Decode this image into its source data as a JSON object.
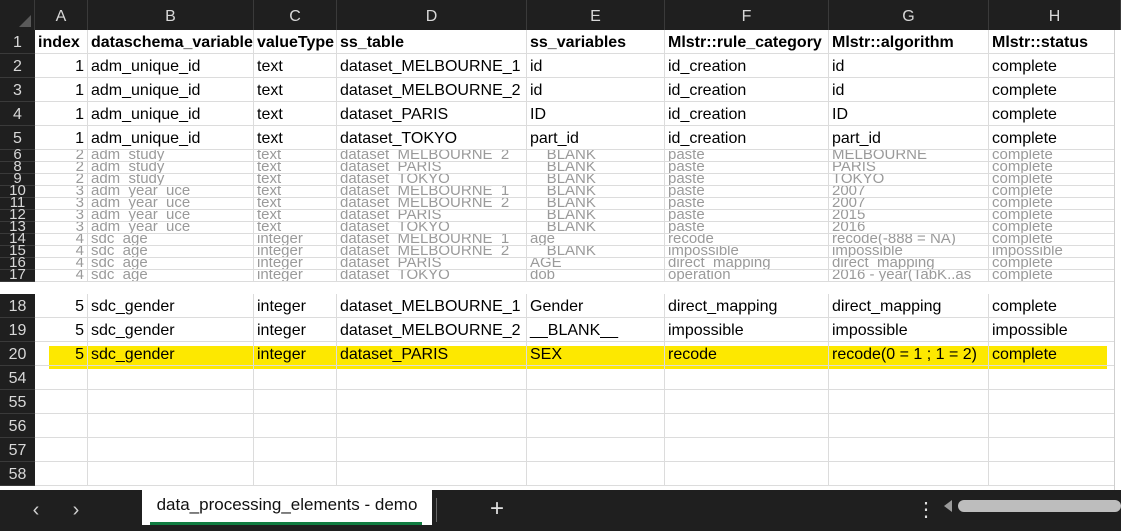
{
  "columns": [
    "A",
    "B",
    "C",
    "D",
    "E",
    "F",
    "G",
    "H"
  ],
  "header_row": {
    "num": "1",
    "cells": [
      "index",
      "dataschema_variable",
      "valueType",
      "ss_table",
      "ss_variables",
      "Mlstr::rule_category",
      "Mlstr::algorithm",
      "Mlstr::status"
    ]
  },
  "rows": [
    {
      "num": "2",
      "cells": [
        "1",
        "adm_unique_id",
        "text",
        "dataset_MELBOURNE_1",
        "id",
        "id_creation",
        "id",
        "complete"
      ]
    },
    {
      "num": "3",
      "cells": [
        "1",
        "adm_unique_id",
        "text",
        "dataset_MELBOURNE_2",
        "id",
        "id_creation",
        "id",
        "complete"
      ]
    },
    {
      "num": "4",
      "cells": [
        "1",
        "adm_unique_id",
        "text",
        "dataset_PARIS",
        "ID",
        "id_creation",
        "ID",
        "complete"
      ]
    },
    {
      "num": "5",
      "cells": [
        "1",
        "adm_unique_id",
        "text",
        "dataset_TOKYO",
        "part_id",
        "id_creation",
        "part_id",
        "complete"
      ]
    }
  ],
  "faded_rows": [
    {
      "num": "6",
      "cells": [
        "2",
        "adm_study",
        "text",
        "dataset_MELBOURNE_2",
        "__BLANK__",
        "paste",
        "MELBOURNE",
        "complete"
      ]
    },
    {
      "num": "8",
      "cells": [
        "2",
        "adm_study",
        "text",
        "dataset_PARIS",
        "__BLANK__",
        "paste",
        "PARIS",
        "complete"
      ]
    },
    {
      "num": "9",
      "cells": [
        "2",
        "adm_study",
        "text",
        "dataset_TOKYO",
        "__BLANK__",
        "paste",
        "TOKYO",
        "complete"
      ]
    },
    {
      "num": "10",
      "cells": [
        "3",
        "adm_year_uce",
        "text",
        "dataset_MELBOURNE_1",
        "__BLANK__",
        "paste",
        "2007",
        "complete"
      ]
    },
    {
      "num": "11",
      "cells": [
        "3",
        "adm_year_uce",
        "text",
        "dataset_MELBOURNE_2",
        "__BLANK__",
        "paste",
        "2007",
        "complete"
      ]
    },
    {
      "num": "12",
      "cells": [
        "3",
        "adm_year_uce",
        "text",
        "dataset_PARIS",
        "__BLANK__",
        "paste",
        "2015",
        "complete"
      ]
    },
    {
      "num": "13",
      "cells": [
        "3",
        "adm_year_uce",
        "text",
        "dataset_TOKYO",
        "__BLANK__",
        "paste",
        "2016",
        "complete"
      ]
    },
    {
      "num": "14",
      "cells": [
        "4",
        "sdc_age",
        "integer",
        "dataset_MELBOURNE_1",
        "age",
        "recode",
        "recode(-888 = NA)",
        "complete"
      ]
    },
    {
      "num": "15",
      "cells": [
        "4",
        "sdc_age",
        "integer",
        "dataset_MELBOURNE_2",
        "__BLANK__",
        "impossible",
        "impossible",
        "impossible"
      ]
    },
    {
      "num": "16",
      "cells": [
        "4",
        "sdc_age",
        "integer",
        "dataset_PARIS",
        "AGE",
        "direct_mapping",
        "direct_mapping",
        "complete"
      ]
    },
    {
      "num": "17",
      "cells": [
        "4",
        "sdc_age",
        "integer",
        "dataset_TOKYO",
        "dob",
        "operation",
        "2016 - year(TabK..as_",
        "complete"
      ]
    }
  ],
  "rows_bottom": [
    {
      "num": "18",
      "cells": [
        "5",
        "sdc_gender",
        "integer",
        "dataset_MELBOURNE_1",
        "Gender",
        "direct_mapping",
        "direct_mapping",
        "complete"
      ]
    },
    {
      "num": "19",
      "cells": [
        "5",
        "sdc_gender",
        "integer",
        "dataset_MELBOURNE_2",
        "__BLANK__",
        "impossible",
        "impossible",
        "impossible"
      ]
    },
    {
      "num": "20",
      "cells": [
        "5",
        "sdc_gender",
        "integer",
        "dataset_PARIS",
        "SEX",
        "recode",
        "recode(0 = 1 ; 1 = 2)",
        "complete"
      ]
    }
  ],
  "empty_rows": [
    "54",
    "55",
    "56",
    "57",
    "58"
  ],
  "highlight_color": "#fde800",
  "tabbar": {
    "prev_icon": "‹",
    "next_icon": "›",
    "sheet_name": "data_processing_elements - demo",
    "add_icon": "+",
    "more_icon": "⋮",
    "accent": "#107c41"
  }
}
